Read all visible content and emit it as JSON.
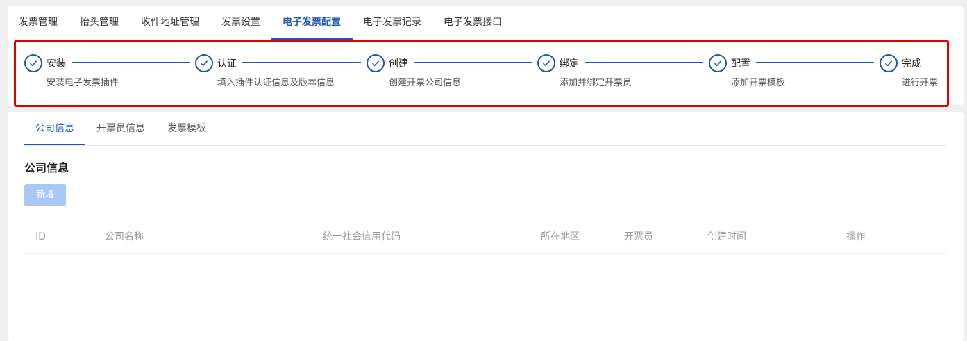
{
  "nav": {
    "tabs": [
      {
        "label": "发票管理"
      },
      {
        "label": "抬头管理"
      },
      {
        "label": "收件地址管理"
      },
      {
        "label": "发票设置"
      },
      {
        "label": "电子发票配置",
        "active": true
      },
      {
        "label": "电子发票记录"
      },
      {
        "label": "电子发票接口"
      }
    ]
  },
  "steps": [
    {
      "title": "安装",
      "desc": "安装电子发票插件",
      "status": "done"
    },
    {
      "title": "认证",
      "desc": "填入插件认证信息及版本信息",
      "status": "done"
    },
    {
      "title": "创建",
      "desc": "创建开票公司信息",
      "status": "done"
    },
    {
      "title": "绑定",
      "desc": "添加并绑定开票员",
      "status": "done"
    },
    {
      "title": "配置",
      "desc": "添加开票模板",
      "status": "done"
    },
    {
      "title": "完成",
      "desc": "进行开票",
      "status": "done"
    }
  ],
  "sub_tabs": [
    {
      "label": "公司信息",
      "active": true
    },
    {
      "label": "开票员信息"
    },
    {
      "label": "发票模板"
    }
  ],
  "section_title": "公司信息",
  "add_button_label": "新增",
  "table": {
    "columns": [
      "ID",
      "公司名称",
      "统一社会信用代码",
      "所在地区",
      "开票员",
      "创建时间",
      "操作"
    ],
    "rows": []
  },
  "colors": {
    "accent": "#1f56b8",
    "highlight_border": "#e00000",
    "disabled_button": "#a9c8f9"
  }
}
